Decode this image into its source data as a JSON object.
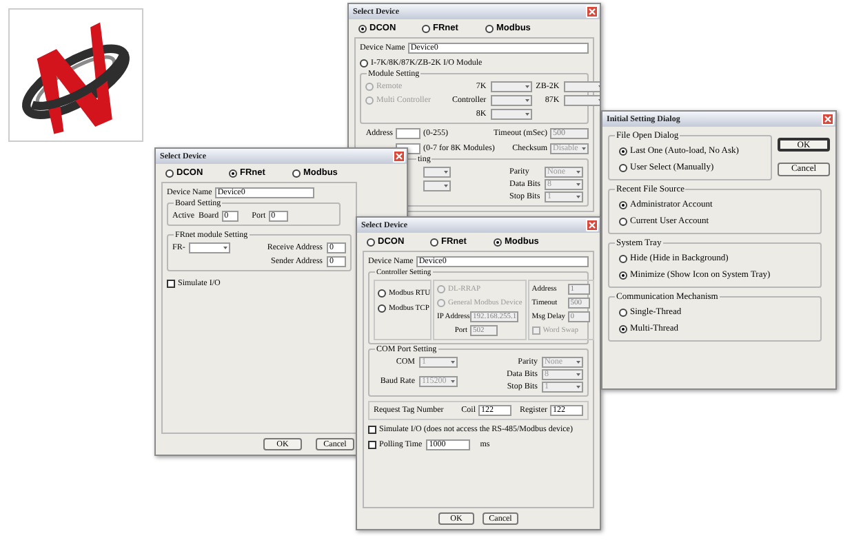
{
  "dcon_dialog": {
    "title": "Select Device",
    "protocols": [
      {
        "label": "DCON",
        "selected": true
      },
      {
        "label": "FRnet",
        "selected": false
      },
      {
        "label": "Modbus",
        "selected": false
      }
    ],
    "device_name": {
      "label": "Device Name",
      "value": "Device0"
    },
    "module_option": {
      "label": "I-7K/8K/87K/ZB-2K I/O Module",
      "selected": false
    },
    "module_setting": {
      "title": "Module Setting",
      "modes": [
        {
          "label": "Remote",
          "selected": false,
          "disabled": true
        },
        {
          "label": "Multi Controller",
          "selected": false,
          "disabled": true
        }
      ],
      "combos": [
        {
          "label": "7K",
          "disabled": true
        },
        {
          "label": "ZB-2K",
          "disabled": true
        },
        {
          "label": "Controller",
          "disabled": true
        },
        {
          "label": "87K",
          "disabled": true
        },
        {
          "label": "8K",
          "disabled": true
        }
      ]
    },
    "address": {
      "label": "Address",
      "hint": "(0-255)",
      "disabled": false
    },
    "slot": {
      "hint": "(0-7 for 8K Modules)",
      "disabled": false
    },
    "timeout": {
      "label": "Timeout (mSec)",
      "value": "500",
      "disabled": true
    },
    "checksum": {
      "label": "Checksum",
      "value": "Disable",
      "disabled": true
    },
    "com_port": {
      "title": "ting",
      "combos": [
        {
          "disabled": true
        },
        {
          "disabled": true
        }
      ],
      "settings": [
        {
          "label": "Parity",
          "value": "None",
          "disabled": true
        },
        {
          "label": "Data Bits",
          "value": "8",
          "disabled": true
        },
        {
          "label": "Stop Bits",
          "value": "1",
          "disabled": true
        }
      ]
    }
  },
  "frnet_dialog": {
    "title": "Select Device",
    "protocols": [
      {
        "label": "DCON",
        "selected": false
      },
      {
        "label": "FRnet",
        "selected": true
      },
      {
        "label": "Modbus",
        "selected": false
      }
    ],
    "device_name": {
      "label": "Device Name",
      "value": "Device0"
    },
    "board_setting": {
      "title": "Board Setting",
      "active_board": {
        "label": "Active  Board",
        "value": "0"
      },
      "port": {
        "label": "Port",
        "value": "0"
      }
    },
    "frnet_setting": {
      "title": "FRnet module Setting",
      "fr": {
        "label": "FR-"
      },
      "receive": {
        "label": "Receive Address",
        "value": "0"
      },
      "sender": {
        "label": "Sender Address",
        "value": "0"
      }
    },
    "simulate": {
      "label": "Simulate I/O",
      "checked": false
    },
    "buttons": [
      "OK",
      "Cancel"
    ]
  },
  "modbus_dialog": {
    "title": "Select Device",
    "protocols": [
      {
        "label": "DCON",
        "selected": false
      },
      {
        "label": "FRnet",
        "selected": false
      },
      {
        "label": "Modbus",
        "selected": true
      }
    ],
    "device_name": {
      "label": "Device Name",
      "value": "Device0"
    },
    "controller_setting": {
      "title": "Controller Setting",
      "modes": [
        {
          "label": "Modbus RTU",
          "selected": false
        },
        {
          "label": "Modbus TCP",
          "selected": false
        }
      ],
      "tcp_modes": [
        {
          "label": "DL-RRAP",
          "selected": false,
          "disabled": true
        },
        {
          "label": "General Modbus Device",
          "selected": false,
          "disabled": true
        }
      ],
      "ip_address": {
        "label": "IP Address",
        "value": "192.168.255.1",
        "disabled": true
      },
      "port": {
        "label": "Port",
        "value": "502",
        "disabled": true
      },
      "address": {
        "label": "Address",
        "value": "1",
        "disabled": true
      },
      "timeout": {
        "label": "Timeout",
        "value": "500",
        "disabled": true
      },
      "msg_delay": {
        "label": "Msg Delay",
        "value": "0",
        "disabled": true
      },
      "word_swap": {
        "label": "Word Swap",
        "checked": false,
        "disabled": true
      }
    },
    "com_port": {
      "title": "COM Port Setting",
      "left": [
        {
          "label": "COM",
          "value": "1",
          "disabled": true
        },
        {
          "label": "Baud Rate",
          "value": "115200",
          "disabled": true
        }
      ],
      "right": [
        {
          "label": "Parity",
          "value": "None",
          "disabled": true
        },
        {
          "label": "Data Bits",
          "value": "8",
          "disabled": true
        },
        {
          "label": "Stop Bits",
          "value": "1",
          "disabled": true
        }
      ]
    },
    "request": {
      "label": "Request Tag Number",
      "coil": {
        "label": "Coil",
        "value": "122"
      },
      "register": {
        "label": "Register",
        "value": "122"
      }
    },
    "simulate": {
      "label": "Simulate I/O (does not access the RS-485/Modbus device)",
      "checked": false
    },
    "polling": {
      "label": "Polling Time",
      "checked": false,
      "value": "1000",
      "unit": "ms"
    },
    "buttons": [
      "OK",
      "Cancel"
    ]
  },
  "initial_dialog": {
    "title": "Initial Setting Dialog",
    "groups": [
      {
        "title": "File Open Dialog",
        "options": [
          {
            "label": "Last One (Auto-load, No Ask)",
            "selected": true
          },
          {
            "label": "User Select (Manually)",
            "selected": false
          }
        ]
      },
      {
        "title": "Recent File Source",
        "options": [
          {
            "label": "Administrator Account",
            "selected": true
          },
          {
            "label": "Current User Account",
            "selected": false
          }
        ]
      },
      {
        "title": "System Tray",
        "options": [
          {
            "label": "Hide (Hide in Background)",
            "selected": false
          },
          {
            "label": "Minimize (Show Icon on System Tray)",
            "selected": true
          }
        ]
      },
      {
        "title": "Communication Mechanism",
        "options": [
          {
            "label": "Single-Thread",
            "selected": false
          },
          {
            "label": "Multi-Thread",
            "selected": true
          }
        ]
      }
    ],
    "buttons": [
      {
        "label": "OK",
        "default": true
      },
      {
        "label": "Cancel",
        "default": false
      }
    ]
  }
}
